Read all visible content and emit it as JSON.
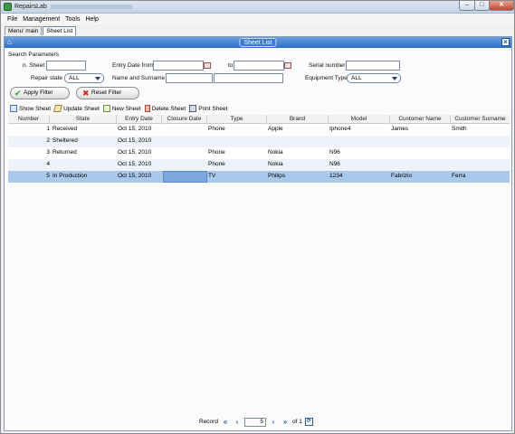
{
  "window": {
    "title": "RepairsLab"
  },
  "menu": [
    "File",
    "Management",
    "Tools",
    "Help"
  ],
  "tabs": [
    {
      "label": "Menu' main",
      "active": false
    },
    {
      "label": "Sheet List",
      "active": true
    }
  ],
  "frame": {
    "title": "Sheet List"
  },
  "search": {
    "section_label": "Search Parameters",
    "n_sheet_label": "n. Sheet",
    "entry_date_from_label": "Entry Date from",
    "to_label": "to",
    "serial_number_label": "Serial number",
    "repair_state_label": "Repair state",
    "repair_state_value": "ALL",
    "name_surname_label": "Name and Surname",
    "equipment_type_label": "Equipment Type",
    "equipment_type_value": "ALL",
    "apply_filter": "Apply Filter",
    "reset_filter": "Reset Filter"
  },
  "toolbar": [
    "Show Sheet",
    "Update Sheet",
    "New Sheet",
    "Delete Sheet",
    "Print Sheet"
  ],
  "table": {
    "columns": [
      "Number",
      "State",
      "Entry Date",
      "Closure Date",
      "Type",
      "Brand",
      "Model",
      "Customer Name",
      "Customer Surname"
    ],
    "rows": [
      [
        "1",
        "Received",
        "Oct 15, 2010",
        "",
        "Phone",
        "Apple",
        "Iphone4",
        "James",
        "Smith"
      ],
      [
        "2",
        "Sheltered",
        "Oct 15, 2010",
        "",
        "",
        "",
        "",
        "",
        ""
      ],
      [
        "3",
        "Returned",
        "Oct 15, 2010",
        "",
        "Phone",
        "Nokia",
        "N96",
        "",
        ""
      ],
      [
        "4",
        "",
        "Oct 15, 2010",
        "",
        "Phone",
        "Nokia",
        "N96",
        "",
        ""
      ],
      [
        "5",
        "In Production",
        "Oct 15, 2010",
        "",
        "TV",
        "Philips",
        "1234",
        "Fabrizio",
        "Ferra"
      ]
    ],
    "selected_row": 5
  },
  "pager": {
    "record_label": "Record",
    "current_page": "5",
    "of_label": "of 1"
  },
  "colors": {
    "accent": "#2f6fc9",
    "selection": "#a8c8ec",
    "selected_cell": "#7ba7df"
  }
}
